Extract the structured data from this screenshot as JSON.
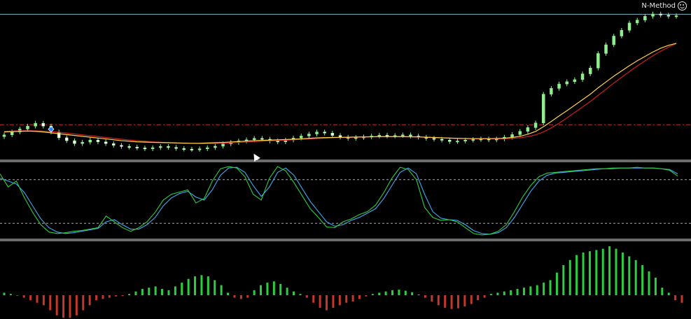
{
  "branding": {
    "indicator_name": "N-Method",
    "smiley_icon": "smiley-icon"
  },
  "colors": {
    "background": "#000000",
    "bull_candle": "#90ee90",
    "bear_candle": "#ffffff",
    "ma_fast": "#ffd24d",
    "ma_slow": "#cc1f1f",
    "stoch_main": "#2ecc40",
    "stoch_signal": "#3fa9f5",
    "hist_positive": "#2ecc40",
    "hist_negative": "#c0392b",
    "level_line": "#c8c8c8",
    "resistance_line": "#cc2a2a",
    "top_line": "#7fb6c8"
  },
  "chart_data": [
    {
      "type": "candlestick",
      "panel": "price",
      "close": [
        100,
        101,
        102,
        103,
        104,
        103,
        101,
        99,
        98,
        97,
        97.5,
        98.2,
        97.6,
        97,
        96.4,
        96,
        95.8,
        95.5,
        95.2,
        95.6,
        96,
        95.7,
        95.3,
        95.1,
        95,
        95.2,
        95.6,
        96.1,
        96.9,
        97.4,
        97.9,
        98.3,
        98.8,
        98.5,
        97.9,
        97.6,
        98.2,
        98.9,
        99.6,
        100.3,
        101,
        100.6,
        99.8,
        99.2,
        98.8,
        99.1,
        99.3,
        99.6,
        99.9,
        99.6,
        99.8,
        100,
        99.6,
        99.2,
        98.8,
        98.5,
        98.2,
        97.7,
        97.9,
        98.2,
        98.4,
        98.6,
        98.3,
        98.6,
        99.2,
        100.1,
        101.2,
        102.5,
        104.1,
        114,
        116,
        117.5,
        118.3,
        119,
        121,
        123,
        128,
        131,
        134,
        136,
        138.5,
        139.5,
        140.8,
        141.6,
        141.2,
        140.8,
        141
      ],
      "ma_fast": [
        101,
        101.1,
        101.2,
        101.3,
        101.2,
        101,
        100.7,
        100.4,
        100.1,
        99.8,
        99.5,
        99.2,
        98.9,
        98.6,
        98.3,
        98,
        97.8,
        97.6,
        97.5,
        97.4,
        97.35,
        97.3,
        97.2,
        97.15,
        97.1,
        97.1,
        97.2,
        97.3,
        97.4,
        97.55,
        97.7,
        97.85,
        98,
        98.1,
        98.2,
        98.3,
        98.4,
        98.5,
        98.6,
        98.8,
        98.95,
        99.05,
        99.1,
        99.15,
        99.2,
        99.25,
        99.3,
        99.35,
        99.4,
        99.4,
        99.4,
        99.4,
        99.35,
        99.3,
        99.2,
        99.1,
        99,
        98.9,
        98.8,
        98.75,
        98.7,
        98.7,
        98.7,
        98.75,
        98.85,
        99.1,
        99.5,
        100.2,
        101.2,
        102.8,
        104.6,
        106.5,
        108.3,
        110.2,
        112.1,
        114,
        116.2,
        118.2,
        120.2,
        122,
        123.8,
        125.5,
        127,
        128.5,
        129.8,
        130.8,
        131.5
      ],
      "ma_slow": [
        101.2,
        101.3,
        101.4,
        101.45,
        101.4,
        101.3,
        101.1,
        100.9,
        100.6,
        100.3,
        100,
        99.7,
        99.4,
        99.1,
        98.8,
        98.5,
        98.25,
        98,
        97.8,
        97.6,
        97.45,
        97.35,
        97.25,
        97.15,
        97.05,
        97,
        97,
        97.05,
        97.15,
        97.25,
        97.4,
        97.55,
        97.7,
        97.85,
        97.95,
        98.05,
        98.15,
        98.3,
        98.45,
        98.6,
        98.75,
        98.9,
        99,
        99.1,
        99.15,
        99.2,
        99.25,
        99.3,
        99.35,
        99.35,
        99.35,
        99.35,
        99.3,
        99.25,
        99.15,
        99.05,
        98.95,
        98.85,
        98.75,
        98.7,
        98.65,
        98.65,
        98.65,
        98.65,
        98.7,
        98.8,
        99,
        99.4,
        100,
        101,
        102.4,
        104,
        105.8,
        107.7,
        109.6,
        111.5,
        113.6,
        115.7,
        117.8,
        119.8,
        121.8,
        123.7,
        125.5,
        127.2,
        128.8,
        130.2,
        131.4
      ],
      "resistance_level": 103.5,
      "top_level": 141.5,
      "title": "",
      "xlabel": "",
      "ylabel": ""
    },
    {
      "type": "line",
      "panel": "stochastic",
      "ylim": [
        0,
        100
      ],
      "levels": [
        80,
        20
      ],
      "series": [
        {
          "values": [
            88,
            70,
            78,
            55,
            35,
            18,
            8,
            6,
            7,
            9,
            10,
            12,
            14,
            30,
            22,
            14,
            9,
            14,
            22,
            35,
            52,
            60,
            63,
            66,
            48,
            54,
            78,
            95,
            98,
            96,
            84,
            60,
            52,
            82,
            98,
            92,
            76,
            58,
            40,
            28,
            15,
            14,
            22,
            26,
            32,
            36,
            45,
            62,
            82,
            97,
            94,
            80,
            42,
            28,
            24,
            25,
            22,
            14,
            6,
            4,
            5,
            9,
            18,
            36,
            56,
            72,
            84,
            89,
            90,
            91,
            92,
            93,
            94,
            95,
            95,
            96,
            96,
            96,
            97,
            96,
            96,
            95,
            93,
            85
          ]
        },
        {
          "values": [
            82,
            78,
            74,
            62,
            44,
            26,
            14,
            8,
            6,
            7,
            9,
            11,
            13,
            22,
            25,
            18,
            12,
            12,
            18,
            28,
            44,
            55,
            61,
            64,
            56,
            52,
            66,
            86,
            96,
            97,
            90,
            72,
            57,
            70,
            90,
            96,
            86,
            68,
            50,
            36,
            22,
            16,
            18,
            24,
            28,
            34,
            40,
            54,
            72,
            90,
            96,
            88,
            60,
            36,
            27,
            25,
            24,
            18,
            10,
            6,
            5,
            7,
            14,
            28,
            46,
            64,
            78,
            86,
            89,
            90,
            91,
            92,
            93,
            94,
            95,
            95,
            96,
            96,
            96,
            96,
            96,
            95,
            94,
            88
          ]
        }
      ]
    },
    {
      "type": "bar",
      "panel": "histogram",
      "values": [
        1,
        0.5,
        0,
        -1,
        -2,
        -3,
        -4,
        -6,
        -8,
        -9,
        -9,
        -8,
        -6,
        -4,
        -2,
        -1.5,
        -1,
        -0.5,
        -0.3,
        0.5,
        1.5,
        2.5,
        3,
        3.5,
        2.5,
        2,
        3.5,
        5,
        6.5,
        7.5,
        8,
        7.5,
        6,
        4,
        1,
        -1,
        -1.5,
        -1,
        2,
        4,
        5,
        5.5,
        4.5,
        3,
        1.5,
        0.5,
        -1,
        -3,
        -5,
        -6,
        -5,
        -4,
        -3,
        -2.5,
        -1.5,
        -0.5,
        0.5,
        1,
        1.5,
        2,
        2.2,
        1.8,
        1.2,
        0.3,
        -1,
        -2.5,
        -4,
        -5,
        -5.5,
        -5.2,
        -4.5,
        -3.5,
        -2,
        -1,
        0.5,
        1,
        1.5,
        2,
        2.5,
        3,
        3.5,
        4,
        5,
        6,
        9,
        12,
        14,
        16,
        17,
        17.5,
        18,
        18.5,
        19.5,
        18.5,
        17,
        15.5,
        14,
        12,
        9.5,
        7,
        3,
        1,
        -2,
        -3
      ]
    }
  ]
}
